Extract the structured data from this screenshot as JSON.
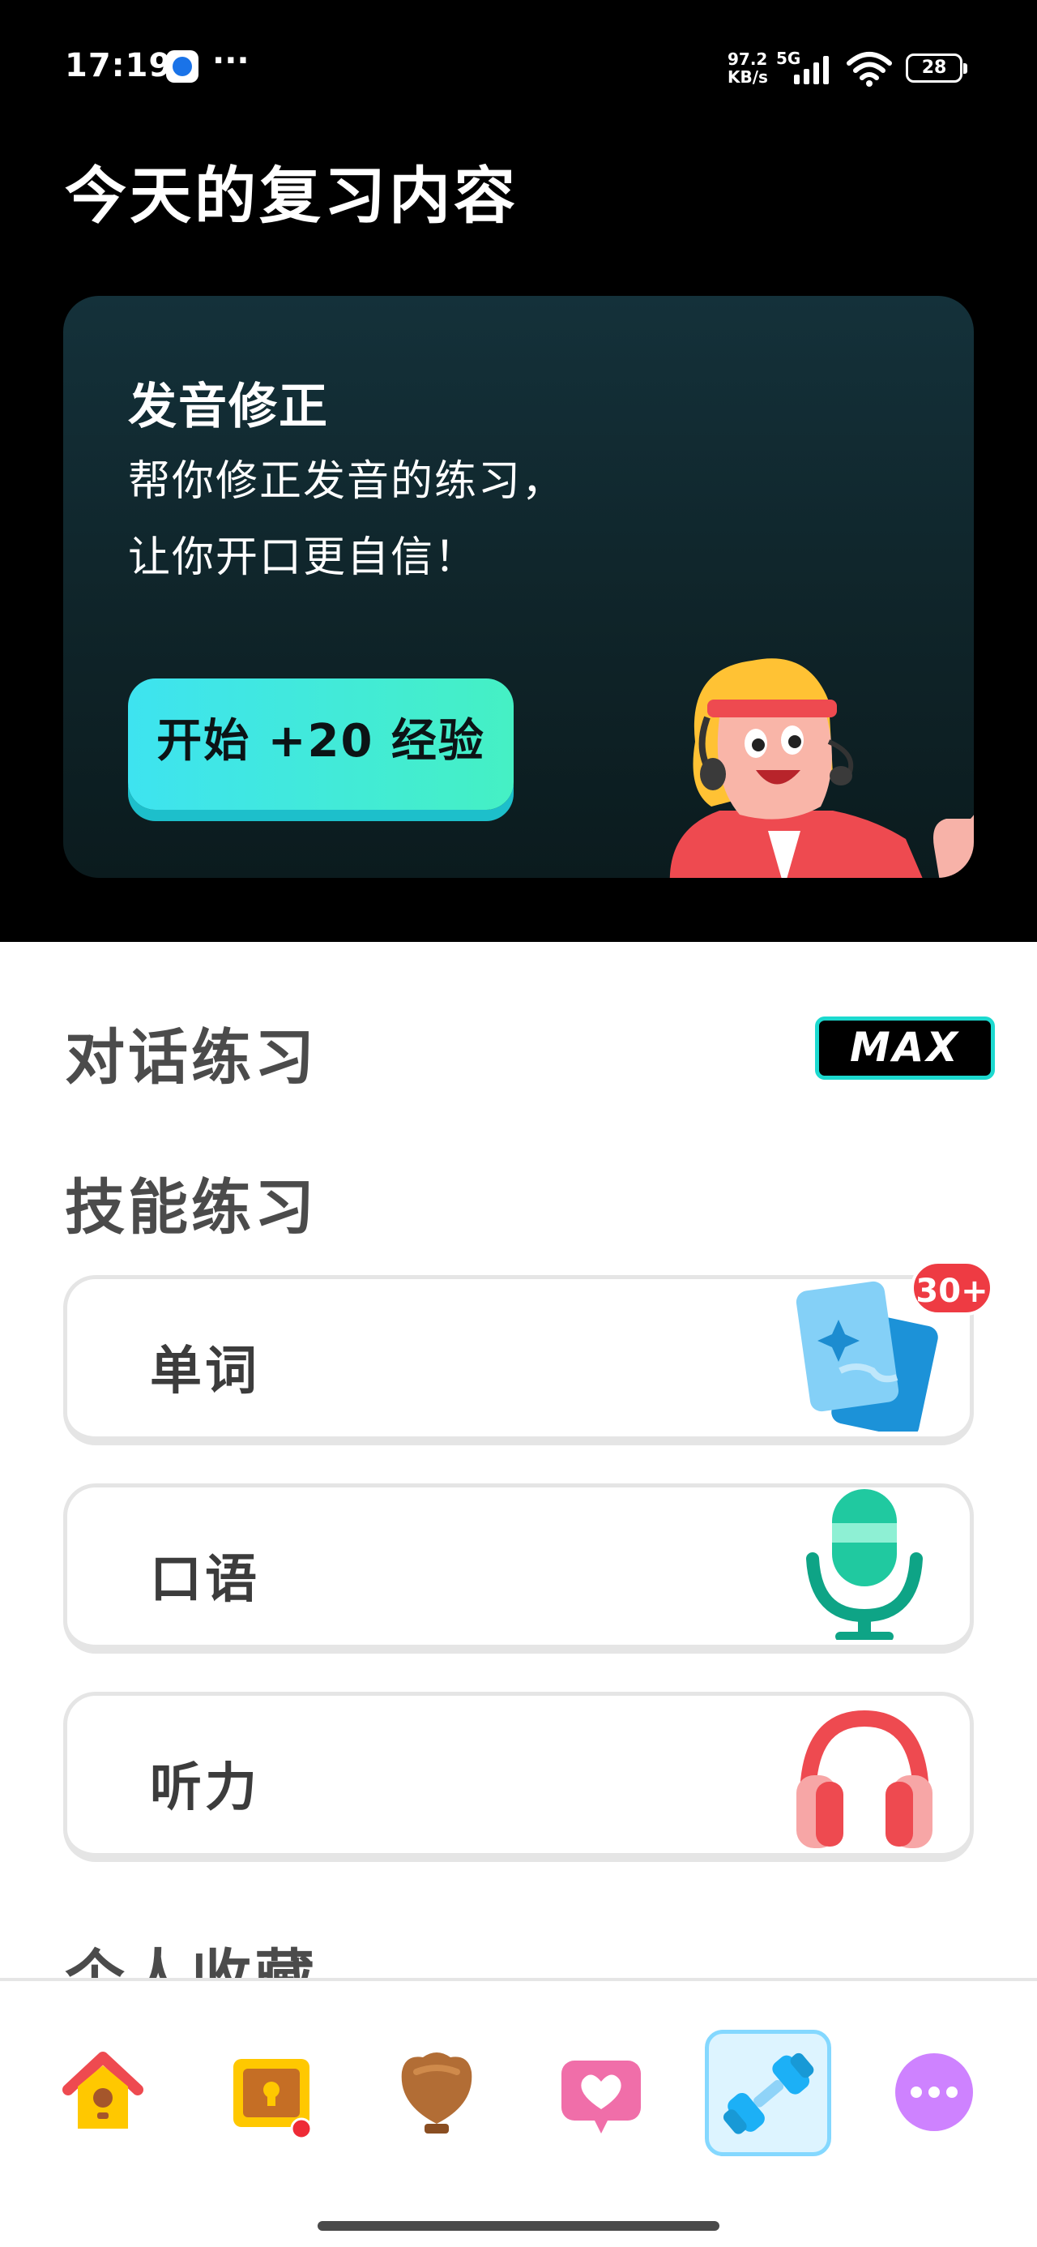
{
  "status": {
    "time": "17:19",
    "speed_value": "97.2",
    "speed_unit": "KB/s",
    "network": "5G",
    "battery": "28",
    "more_icon": "ellipsis-icon"
  },
  "header": {
    "title": "今天的复习内容"
  },
  "promo_card": {
    "title": "发音修正",
    "desc_line1": "帮你修正发音的练习，",
    "desc_line2": "让你开口更自信！",
    "button_label": "开始 +20 经验",
    "illustration": "coach-character-icon"
  },
  "sections": {
    "conversation": "对话练习",
    "conversation_badge": "MAX",
    "skills": "技能练习",
    "favorites": "个人收藏"
  },
  "skills": [
    {
      "label": "单词",
      "icon": "flashcards-icon",
      "badge": "30+"
    },
    {
      "label": "口语",
      "icon": "microphone-icon"
    },
    {
      "label": "听力",
      "icon": "headphones-icon"
    }
  ],
  "nav": [
    {
      "name": "home",
      "icon": "birdhouse-icon"
    },
    {
      "name": "quests",
      "icon": "treasure-chest-icon"
    },
    {
      "name": "leagues",
      "icon": "trophy-shield-icon"
    },
    {
      "name": "friends",
      "icon": "heart-speech-icon"
    },
    {
      "name": "practice",
      "icon": "dumbbell-icon",
      "active": true
    },
    {
      "name": "more",
      "icon": "more-dots-icon"
    }
  ],
  "colors": {
    "accent_cyan": "#3ee3f0",
    "badge_red": "#ee3b43",
    "active_nav": "#84d8ff"
  }
}
